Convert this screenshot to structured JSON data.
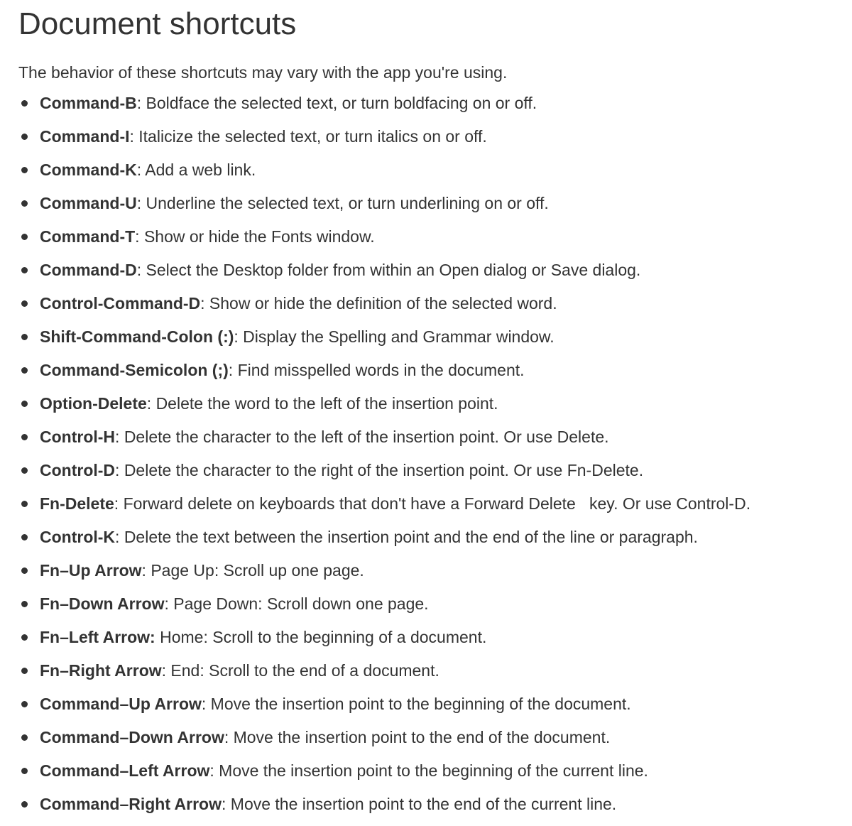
{
  "page": {
    "title": "Document shortcuts",
    "intro": "The behavior of these shortcuts may vary with the app you're using."
  },
  "shortcuts": [
    {
      "keys": "Command-B",
      "sep": ": ",
      "desc": "Boldface the selected text, or turn boldfacing on or off."
    },
    {
      "keys": "Command-I",
      "sep": ": ",
      "desc": "Italicize the selected text, or turn italics on or off."
    },
    {
      "keys": "Command-K",
      "sep": ": ",
      "desc": "Add a web link."
    },
    {
      "keys": "Command-U",
      "sep": ": ",
      "desc": "Underline the selected text, or turn underlining on or off."
    },
    {
      "keys": "Command-T",
      "sep": ": ",
      "desc": "Show or hide the Fonts window."
    },
    {
      "keys": "Command-D",
      "sep": ": ",
      "desc": "Select the Desktop folder from within an Open dialog or Save dialog."
    },
    {
      "keys": "Control-Command-D",
      "sep": ": ",
      "desc": "Show or hide the definition of the selected word."
    },
    {
      "keys": "Shift-Command-Colon (:)",
      "sep": ": ",
      "desc": "Display the Spelling and Grammar window."
    },
    {
      "keys": "Command-Semicolon (;)",
      "sep": ": ",
      "desc": "Find misspelled words in the document."
    },
    {
      "keys": "Option-Delete",
      "sep": ": ",
      "desc": "Delete the word to the left of the insertion point."
    },
    {
      "keys": "Control-H",
      "sep": ": ",
      "desc": "Delete the character to the left of the insertion point. Or use Delete."
    },
    {
      "keys": "Control-D",
      "sep": ": ",
      "desc": "Delete the character to the right of the insertion point. Or use Fn-Delete."
    },
    {
      "keys": "Fn-Delete",
      "sep": ": ",
      "desc": "Forward delete on keyboards that don't have a Forward Delete   key. Or use Control-D."
    },
    {
      "keys": "Control-K",
      "sep": ": ",
      "desc": "Delete the text between the insertion point and the end of the line or paragraph."
    },
    {
      "keys": "Fn–Up Arrow",
      "sep": ": ",
      "desc": "Page Up: Scroll up one page."
    },
    {
      "keys": "Fn–Down Arrow",
      "sep": ": ",
      "desc": "Page Down: Scroll down one page."
    },
    {
      "keys": "Fn–Left Arrow:",
      "sep": " ",
      "desc": "Home: Scroll to the beginning of a document."
    },
    {
      "keys": "Fn–Right Arrow",
      "sep": ": ",
      "desc": "End: Scroll to the end of a document."
    },
    {
      "keys": "Command–Up Arrow",
      "sep": ": ",
      "desc": "Move the insertion point to the beginning of the document."
    },
    {
      "keys": "Command–Down Arrow",
      "sep": ": ",
      "desc": "Move the insertion point to the end of the document."
    },
    {
      "keys": "Command–Left Arrow",
      "sep": ": ",
      "desc": "Move the insertion point to the beginning of the current line."
    },
    {
      "keys": "Command–Right Arrow",
      "sep": ": ",
      "desc": "Move the insertion point to the end of the current line."
    }
  ]
}
